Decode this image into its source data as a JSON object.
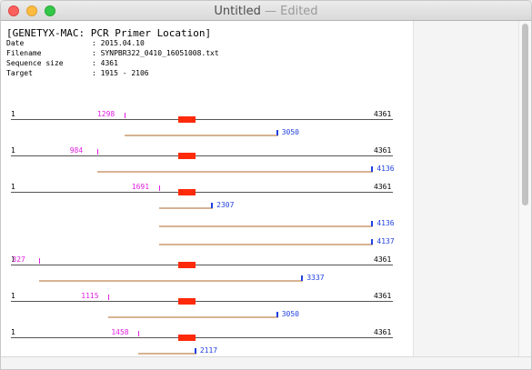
{
  "window": {
    "title": "Untitled",
    "edited": "— Edited"
  },
  "document": {
    "header": "[GENETYX-MAC: PCR Primer Location]",
    "meta": [
      {
        "key": "Date",
        "value": ": 2015.04.10"
      },
      {
        "key": "Filename",
        "value": ": SYNPBR322_0410_16051008.txt"
      },
      {
        "key": "Sequence size",
        "value": ": 4361"
      },
      {
        "key": "Target",
        "value": ": 1915 - 2106"
      }
    ],
    "sequence": {
      "start": "1",
      "end": "4361",
      "target_start": 1915,
      "target_end": 2106
    },
    "primer_pairs": [
      {
        "forward": "1298",
        "reverses": [
          "3050"
        ]
      },
      {
        "forward": "984",
        "reverses": [
          "4136"
        ]
      },
      {
        "forward": "1691",
        "reverses": [
          "2307",
          "4136",
          "4137"
        ]
      },
      {
        "forward": "327",
        "reverses": [
          "3337"
        ]
      },
      {
        "forward": "1115",
        "reverses": [
          "3050"
        ]
      },
      {
        "forward": "1458",
        "reverses": [
          "2117"
        ]
      }
    ]
  },
  "colors": {
    "sequence_line": "#555555",
    "target_amplicon": "#ff2a0a",
    "forward_primer": "#e020e0",
    "reverse_primer": "#2040e0",
    "pcr_product": "#d7b393"
  }
}
